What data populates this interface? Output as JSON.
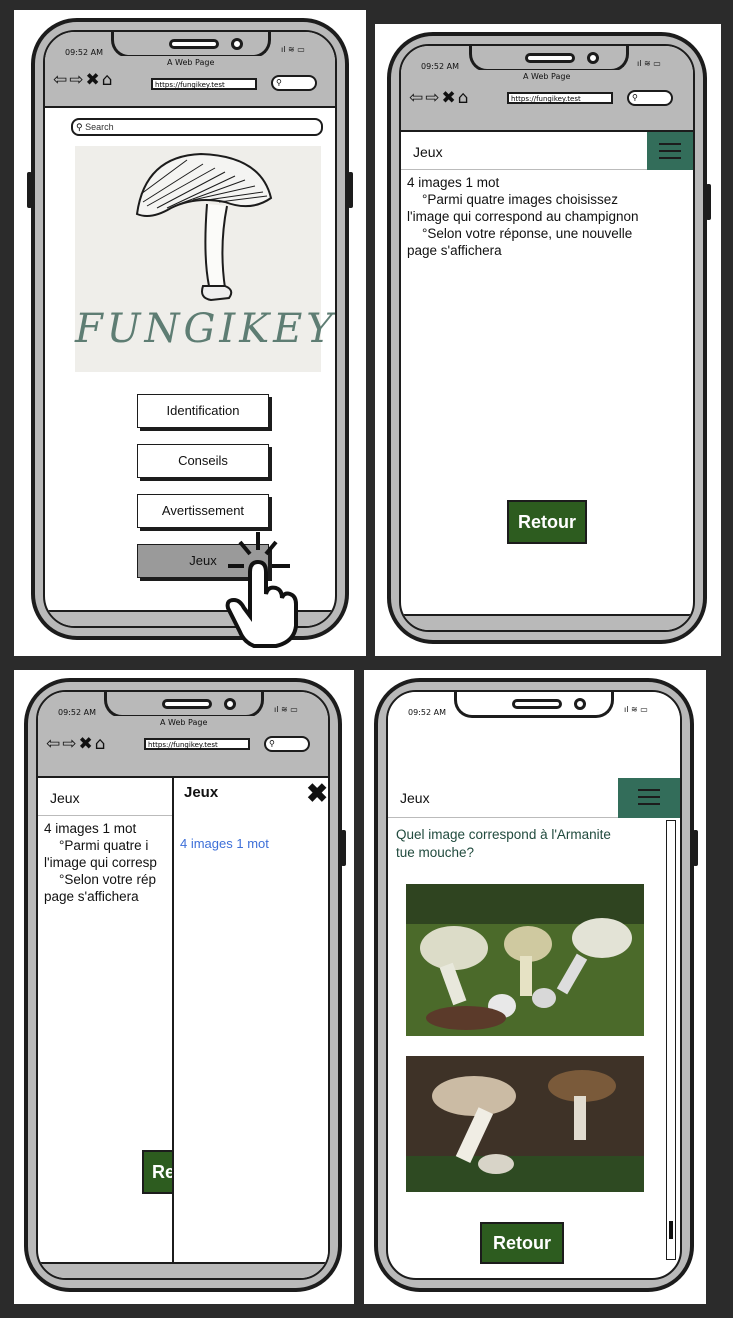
{
  "common": {
    "time": "09:52 AM",
    "page_title": "A Web Page",
    "url": "https://fungikey.test",
    "nav_icons": "⇦⇨✖⌂",
    "signal": "ıl ≋ ▭",
    "colors": {
      "accent_green": "#336d5a",
      "button_green": "#2d5c1f",
      "link_blue": "#3d6fd8"
    }
  },
  "screen1": {
    "search_placeholder": "Search",
    "logo_text": "FUNGIKEY",
    "buttons": [
      "Identification",
      "Conseils",
      "Avertissement",
      "Jeux"
    ],
    "active_button": "Jeux"
  },
  "screen2": {
    "header_title": "Jeux",
    "lines": [
      "4 images 1 mot",
      "    °Parmi quatre images choisissez",
      "l'image qui correspond au champignon",
      "    °Selon votre réponse, une nouvelle",
      "page s'affichera"
    ],
    "retour_label": "Retour"
  },
  "screen3": {
    "header_title": "Jeux",
    "lines": [
      "4 images 1 mot",
      "    °Parmi quatre i",
      "l'image qui corresp",
      "    °Selon votre rép",
      "page s'affichera"
    ],
    "retour_partial": "Re",
    "drawer_title": "Jeux",
    "drawer_link": "4 images 1 mot"
  },
  "screen4": {
    "header_title": "Jeux",
    "question": "Quel image correspond à l'Armanite\ntue mouche?",
    "retour_label": "Retour"
  }
}
